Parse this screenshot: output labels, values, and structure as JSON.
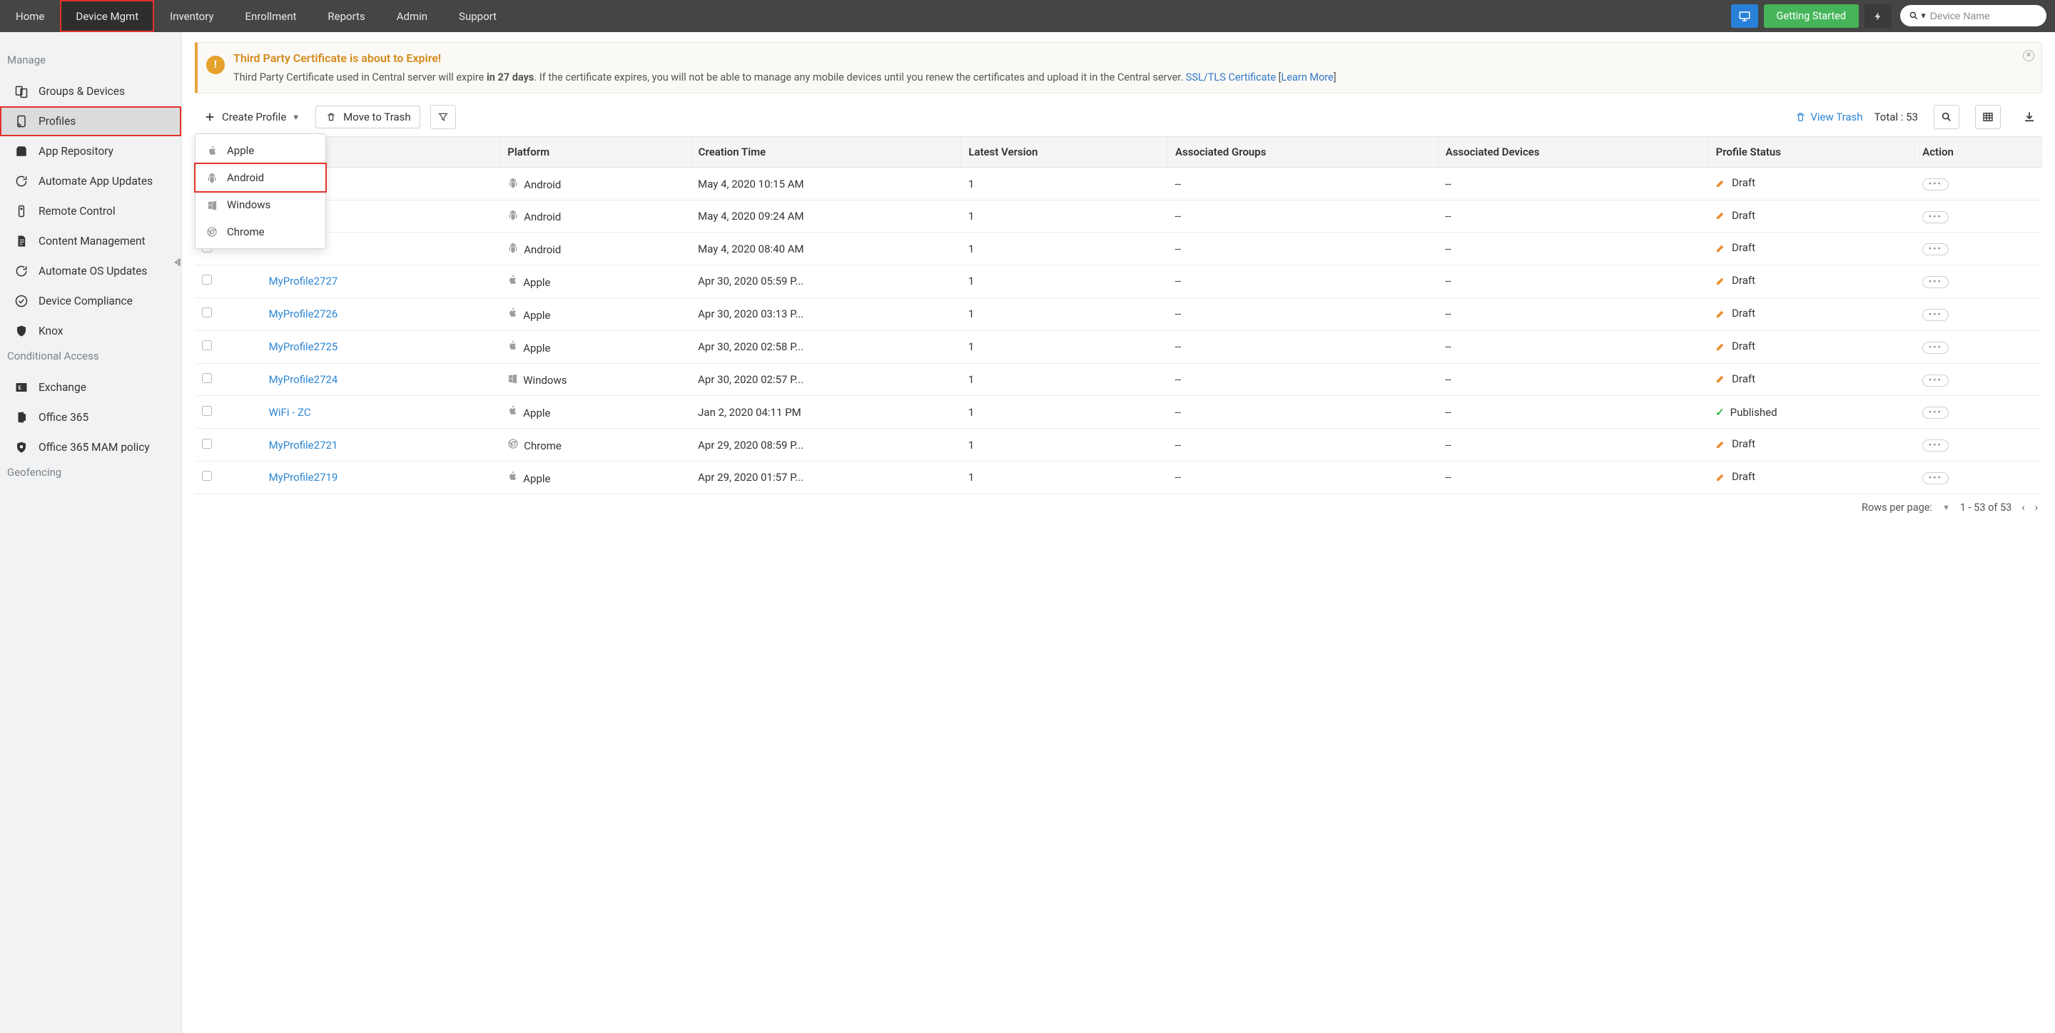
{
  "topnav": {
    "items": [
      {
        "label": "Home"
      },
      {
        "label": "Device Mgmt",
        "active": true,
        "highlight": true
      },
      {
        "label": "Inventory"
      },
      {
        "label": "Enrollment"
      },
      {
        "label": "Reports"
      },
      {
        "label": "Admin"
      },
      {
        "label": "Support"
      }
    ],
    "getting_started": "Getting Started",
    "search_placeholder": "Device Name"
  },
  "sidebar": {
    "sections": [
      {
        "label": "Manage",
        "items": [
          {
            "icon": "groups-devices-icon",
            "label": "Groups & Devices"
          },
          {
            "icon": "profiles-icon",
            "label": "Profiles",
            "active": true,
            "highlight": true
          },
          {
            "icon": "app-repo-icon",
            "label": "App Repository"
          },
          {
            "icon": "auto-app-updates-icon",
            "label": "Automate App Updates"
          },
          {
            "icon": "remote-control-icon",
            "label": "Remote Control"
          },
          {
            "icon": "content-mgmt-icon",
            "label": "Content Management"
          },
          {
            "icon": "auto-os-updates-icon",
            "label": "Automate OS Updates"
          },
          {
            "icon": "compliance-icon",
            "label": "Device Compliance"
          },
          {
            "icon": "knox-icon",
            "label": "Knox"
          }
        ]
      },
      {
        "label": "Conditional Access",
        "items": [
          {
            "icon": "exchange-icon",
            "label": "Exchange"
          },
          {
            "icon": "office365-icon",
            "label": "Office 365"
          },
          {
            "icon": "mam-icon",
            "label": "Office 365 MAM policy"
          }
        ]
      },
      {
        "label": "Geofencing",
        "items": []
      }
    ]
  },
  "alert": {
    "title": "Third Party Certificate is about to Expire!",
    "prefix": "Third Party Certificate used in Central server will expire ",
    "bold": "in 27 days",
    "suffix": ". If the certificate expires, you will not be able to manage any mobile devices until you renew the certificates and upload it in the Central server. ",
    "link1": "SSL/TLS Certificate",
    "learn_more": "Learn More"
  },
  "toolbar": {
    "create_profile": "Create Profile",
    "move_to_trash": "Move to Trash",
    "view_trash": "View Trash",
    "total_label": "Total : 53"
  },
  "dropdown": {
    "items": [
      {
        "icon": "apple-icon",
        "label": "Apple"
      },
      {
        "icon": "android-icon",
        "label": "Android",
        "highlight": true
      },
      {
        "icon": "windows-icon",
        "label": "Windows"
      },
      {
        "icon": "chrome-icon",
        "label": "Chrome"
      }
    ]
  },
  "table": {
    "headers": {
      "platform": "Platform",
      "creation_time": "Creation Time",
      "latest_version": "Latest Version",
      "assoc_groups": "Associated Groups",
      "assoc_devices": "Associated Devices",
      "profile_status": "Profile Status",
      "action": "Action"
    },
    "rows": [
      {
        "name": "",
        "platform": "Android",
        "time": "May 4, 2020 10:15 AM",
        "version": "1",
        "groups": "--",
        "devices": "--",
        "status": "Draft"
      },
      {
        "name": "",
        "platform": "Android",
        "time": "May 4, 2020 09:24 AM",
        "version": "1",
        "groups": "--",
        "devices": "--",
        "status": "Draft"
      },
      {
        "name": "",
        "platform": "Android",
        "time": "May 4, 2020 08:40 AM",
        "version": "1",
        "groups": "--",
        "devices": "--",
        "status": "Draft"
      },
      {
        "name": "MyProfile2727",
        "platform": "Apple",
        "time": "Apr 30, 2020 05:59 P...",
        "version": "1",
        "groups": "--",
        "devices": "--",
        "status": "Draft"
      },
      {
        "name": "MyProfile2726",
        "platform": "Apple",
        "time": "Apr 30, 2020 03:13 P...",
        "version": "1",
        "groups": "--",
        "devices": "--",
        "status": "Draft"
      },
      {
        "name": "MyProfile2725",
        "platform": "Apple",
        "time": "Apr 30, 2020 02:58 P...",
        "version": "1",
        "groups": "--",
        "devices": "--",
        "status": "Draft"
      },
      {
        "name": "MyProfile2724",
        "platform": "Windows",
        "time": "Apr 30, 2020 02:57 P...",
        "version": "1",
        "groups": "--",
        "devices": "--",
        "status": "Draft"
      },
      {
        "name": "WiFi - ZC",
        "platform": "Apple",
        "time": "Jan 2, 2020 04:11 PM",
        "version": "1",
        "groups": "--",
        "devices": "--",
        "status": "Published"
      },
      {
        "name": "MyProfile2721",
        "platform": "Chrome",
        "time": "Apr 29, 2020 08:59 P...",
        "version": "1",
        "groups": "--",
        "devices": "--",
        "status": "Draft"
      },
      {
        "name": "MyProfile2719",
        "platform": "Apple",
        "time": "Apr 29, 2020 01:57 P...",
        "version": "1",
        "groups": "--",
        "devices": "--",
        "status": "Draft"
      }
    ]
  },
  "pager": {
    "rows_per_page": "Rows per page:",
    "range": "1 - 53 of 53"
  }
}
